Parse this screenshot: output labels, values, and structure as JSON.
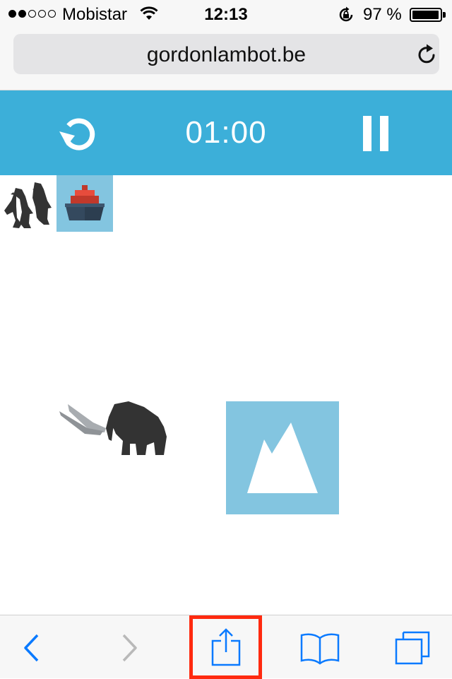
{
  "status_bar": {
    "signal_strength": 2,
    "signal_max": 5,
    "carrier": "Mobistar",
    "time": "12:13",
    "battery_percent": "97 %",
    "battery_level": 0.97,
    "icons": [
      "wifi-icon",
      "orientation-lock-icon",
      "battery-icon"
    ]
  },
  "browser": {
    "url": "gordonlambot.be",
    "reload_icon": "reload-icon"
  },
  "game": {
    "timer": "01:00",
    "restart_icon": "restart-icon",
    "pause_icon": "pause-icon",
    "header_color": "#3cafd9",
    "tile_color": "#83c5e0",
    "tiles": [
      "penguins",
      "ship",
      "mammoth",
      "mountain"
    ]
  },
  "toolbar": {
    "items": [
      "back-icon",
      "forward-icon",
      "share-icon",
      "bookmarks-icon",
      "tabs-icon"
    ],
    "accent_color": "#0a7aff",
    "disabled_color": "#b9b9b9",
    "highlight_color": "#ff2a0f"
  }
}
